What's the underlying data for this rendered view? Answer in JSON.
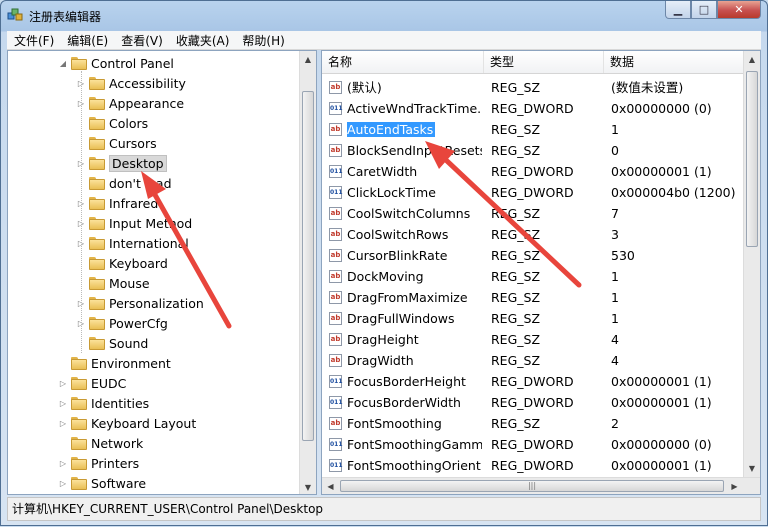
{
  "window": {
    "title": "注册表编辑器"
  },
  "menu": [
    "文件(F)",
    "编辑(E)",
    "查看(V)",
    "收藏夹(A)",
    "帮助(H)"
  ],
  "tree": [
    {
      "label": "Control Panel",
      "level": 0,
      "arrow": "◢"
    },
    {
      "label": "Accessibility",
      "level": 1,
      "arrow": "▷"
    },
    {
      "label": "Appearance",
      "level": 1,
      "arrow": "▷"
    },
    {
      "label": "Colors",
      "level": 1,
      "arrow": ""
    },
    {
      "label": "Cursors",
      "level": 1,
      "arrow": ""
    },
    {
      "label": "Desktop",
      "level": 1,
      "arrow": "▷",
      "selected": true
    },
    {
      "label": "don't load",
      "level": 1,
      "arrow": ""
    },
    {
      "label": "Infrared",
      "level": 1,
      "arrow": "▷"
    },
    {
      "label": "Input Method",
      "level": 1,
      "arrow": "▷"
    },
    {
      "label": "International",
      "level": 1,
      "arrow": "▷"
    },
    {
      "label": "Keyboard",
      "level": 1,
      "arrow": ""
    },
    {
      "label": "Mouse",
      "level": 1,
      "arrow": ""
    },
    {
      "label": "Personalization",
      "level": 1,
      "arrow": "▷"
    },
    {
      "label": "PowerCfg",
      "level": 1,
      "arrow": "▷"
    },
    {
      "label": "Sound",
      "level": 1,
      "arrow": ""
    },
    {
      "label": "Environment",
      "level": 0,
      "arrow": ""
    },
    {
      "label": "EUDC",
      "level": 0,
      "arrow": "▷"
    },
    {
      "label": "Identities",
      "level": 0,
      "arrow": "▷"
    },
    {
      "label": "Keyboard Layout",
      "level": 0,
      "arrow": "▷"
    },
    {
      "label": "Network",
      "level": 0,
      "arrow": ""
    },
    {
      "label": "Printers",
      "level": 0,
      "arrow": "▷"
    },
    {
      "label": "Software",
      "level": 0,
      "arrow": "▷"
    }
  ],
  "columns": [
    "名称",
    "类型",
    "数据"
  ],
  "values": [
    {
      "name": "(默认)",
      "type": "REG_SZ",
      "data": "(数值未设置)",
      "kind": "sz"
    },
    {
      "name": "ActiveWndTrackTime...",
      "type": "REG_DWORD",
      "data": "0x00000000 (0)",
      "kind": "dword"
    },
    {
      "name": "AutoEndTasks",
      "type": "REG_SZ",
      "data": "1",
      "kind": "sz",
      "selected": true
    },
    {
      "name": "BlockSendInputResets",
      "type": "REG_SZ",
      "data": "0",
      "kind": "sz"
    },
    {
      "name": "CaretWidth",
      "type": "REG_DWORD",
      "data": "0x00000001 (1)",
      "kind": "dword"
    },
    {
      "name": "ClickLockTime",
      "type": "REG_DWORD",
      "data": "0x000004b0 (1200)",
      "kind": "dword"
    },
    {
      "name": "CoolSwitchColumns",
      "type": "REG_SZ",
      "data": "7",
      "kind": "sz"
    },
    {
      "name": "CoolSwitchRows",
      "type": "REG_SZ",
      "data": "3",
      "kind": "sz"
    },
    {
      "name": "CursorBlinkRate",
      "type": "REG_SZ",
      "data": "530",
      "kind": "sz"
    },
    {
      "name": "DockMoving",
      "type": "REG_SZ",
      "data": "1",
      "kind": "sz"
    },
    {
      "name": "DragFromMaximize",
      "type": "REG_SZ",
      "data": "1",
      "kind": "sz"
    },
    {
      "name": "DragFullWindows",
      "type": "REG_SZ",
      "data": "1",
      "kind": "sz"
    },
    {
      "name": "DragHeight",
      "type": "REG_SZ",
      "data": "4",
      "kind": "sz"
    },
    {
      "name": "DragWidth",
      "type": "REG_SZ",
      "data": "4",
      "kind": "sz"
    },
    {
      "name": "FocusBorderHeight",
      "type": "REG_DWORD",
      "data": "0x00000001 (1)",
      "kind": "dword"
    },
    {
      "name": "FocusBorderWidth",
      "type": "REG_DWORD",
      "data": "0x00000001 (1)",
      "kind": "dword"
    },
    {
      "name": "FontSmoothing",
      "type": "REG_SZ",
      "data": "2",
      "kind": "sz"
    },
    {
      "name": "FontSmoothingGamma",
      "type": "REG_DWORD",
      "data": "0x00000000 (0)",
      "kind": "dword"
    },
    {
      "name": "FontSmoothingOrient...",
      "type": "REG_DWORD",
      "data": "0x00000001 (1)",
      "kind": "dword"
    }
  ],
  "status": {
    "path": "计算机\\HKEY_CURRENT_USER\\Control Panel\\Desktop"
  },
  "colors": {
    "selection": "#3399ff",
    "arrow": "#e8453c"
  }
}
